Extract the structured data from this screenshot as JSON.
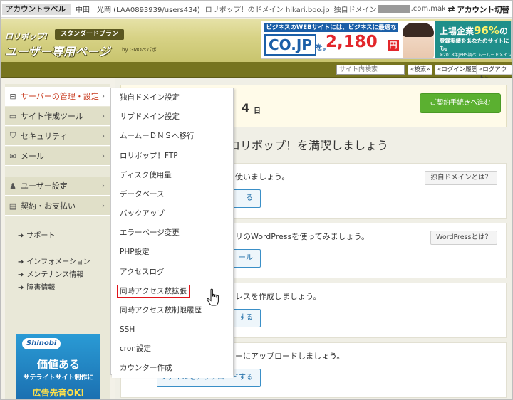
{
  "account_bar": {
    "label": "アカウントラベル",
    "user": "中田　光岡 (LAA0893939/users434)",
    "domain": "ロリポップ！のドメイン hikari.boo.jp",
    "own_domain_label": "独自ドメイン",
    "own_domain_suffix": ".com,make-",
    "switch_icon": "⇄",
    "switch_label": "アカウント切替"
  },
  "header": {
    "logo_small": "ロリポップ!",
    "plan": "スタンダードプラン",
    "logo_big": "ユーザー専用ページ",
    "logo_by": "by GMOペパボ",
    "ad": {
      "top": "ビジネスのWEBサイトには、ビジネスに最適な",
      "co": "CO.JP",
      "wo": "を。",
      "price": "2,180",
      "yen": "円",
      "right_title": "上場企業",
      "right_percent": "96%",
      "right_suffix": "の",
      "right_sub": "登録実績をあなたのサイトにも。",
      "right_sub2": "ムームードメイン by GMOペパボ",
      "right_note": "※2018年JPRS調べ"
    }
  },
  "navbar": {
    "search_placeholder": "サイト内検索",
    "search_button": "検索",
    "login_history": "ログイン履歴",
    "logout": "ログアウト"
  },
  "sidebar": {
    "items": [
      {
        "label": "サーバーの管理・設定",
        "icon": "server-icon",
        "glyph": "⊟"
      },
      {
        "label": "サイト作成ツール",
        "icon": "monitor-icon",
        "glyph": "▭"
      },
      {
        "label": "セキュリティ",
        "icon": "shield-icon",
        "glyph": "⛉"
      },
      {
        "label": "メール",
        "icon": "mail-icon",
        "glyph": "✉"
      },
      {
        "label": "ユーザー設定",
        "icon": "user-icon",
        "glyph": "♟"
      },
      {
        "label": "契約・お支払い",
        "icon": "card-icon",
        "glyph": "▤"
      }
    ],
    "caret": "›",
    "links": [
      "サポート",
      "インフォメーション",
      "メンテナンス情報",
      "障害情報"
    ],
    "arrow": "➔",
    "shinobi": {
      "logo": "Shinobi",
      "title": "価値ある",
      "sub": "サテライトサイト制作に",
      "bottom": "広告先音OK!"
    }
  },
  "main": {
    "date_number": "4",
    "date_unit": "日",
    "contract_button": "ご契約手続きへ進む",
    "welcome": "ロリポップ！を満喫しましょう",
    "cards": [
      {
        "text": "使いましょう。",
        "button": "る",
        "help": "独自ドメインとは？"
      },
      {
        "text": "リのWordPressを使ってみましょう。",
        "button": "ール",
        "help": "WordPressとは？"
      },
      {
        "text": "レスを作成しましょう。",
        "button": "する",
        "help": ""
      },
      {
        "text": "ーにアップロードしましょう。",
        "button": "ファイルをアップロードする",
        "help": ""
      }
    ]
  },
  "menu": {
    "items": [
      "独自ドメイン設定",
      "サブドメイン設定",
      "ムームーＤＮＳへ移行",
      "ロリポップ！FTP",
      "ディスク使用量",
      "データベース",
      "バックアップ",
      "エラーページ変更",
      "PHP設定",
      "アクセスログ",
      "同時アクセス数拡張",
      "同時アクセス数制限履歴",
      "SSH",
      "cron設定",
      "カウンター作成"
    ],
    "highlighted": "同時アクセス数拡張"
  },
  "colors": {
    "header": "#d7d285",
    "navbar": "#76741f",
    "accent_red": "#e24a1f",
    "contract_green": "#5bb030",
    "link_blue": "#1f6ea8"
  }
}
